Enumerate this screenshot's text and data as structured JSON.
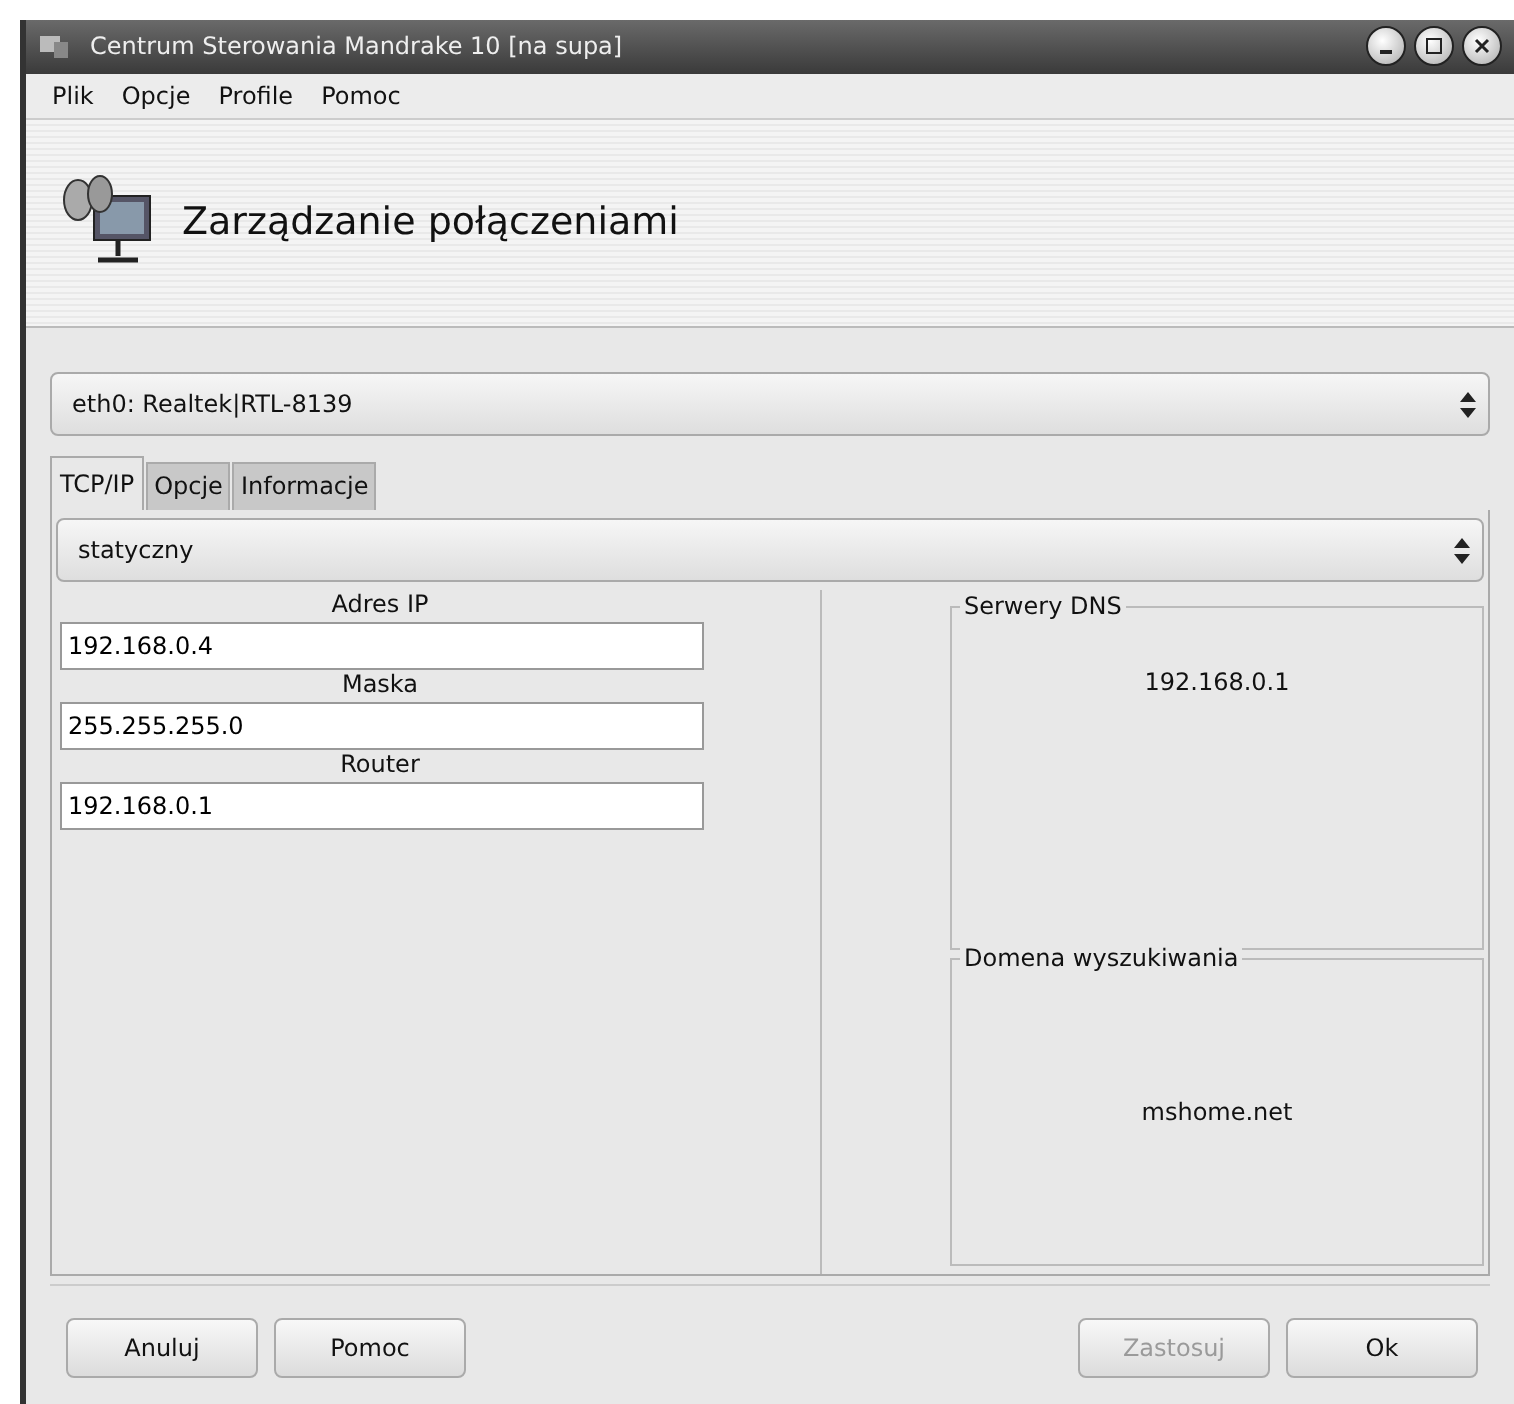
{
  "window": {
    "title": "Centrum Sterowania Mandrake 10 [na supa]"
  },
  "menu": [
    {
      "label": "Plik"
    },
    {
      "label": "Opcje"
    },
    {
      "label": "Profile"
    },
    {
      "label": "Pomoc"
    }
  ],
  "header": {
    "title": "Zarządzanie połączeniami"
  },
  "interface_select": {
    "value": "eth0: Realtek|RTL-8139"
  },
  "tabs": [
    {
      "label": "TCP/IP",
      "selected": true
    },
    {
      "label": "Opcje",
      "selected": false
    },
    {
      "label": "Informacje",
      "selected": false
    }
  ],
  "mode_select": {
    "value": "statyczny"
  },
  "fields": [
    {
      "label": "Adres IP",
      "value": "192.168.0.4"
    },
    {
      "label": "Maska",
      "value": "255.255.255.0"
    },
    {
      "label": "Router",
      "value": "192.168.0.1"
    }
  ],
  "groups": [
    {
      "title": "Serwery DNS",
      "value": "192.168.0.1"
    },
    {
      "title": "Domena wyszukiwania",
      "value": "mshome.net"
    }
  ],
  "buttons_left": [
    {
      "label": "Anuluj",
      "disabled": false
    },
    {
      "label": "Pomoc",
      "disabled": false
    }
  ],
  "buttons_right": [
    {
      "label": "Zastosuj",
      "disabled": true
    },
    {
      "label": "Ok",
      "disabled": false
    }
  ]
}
